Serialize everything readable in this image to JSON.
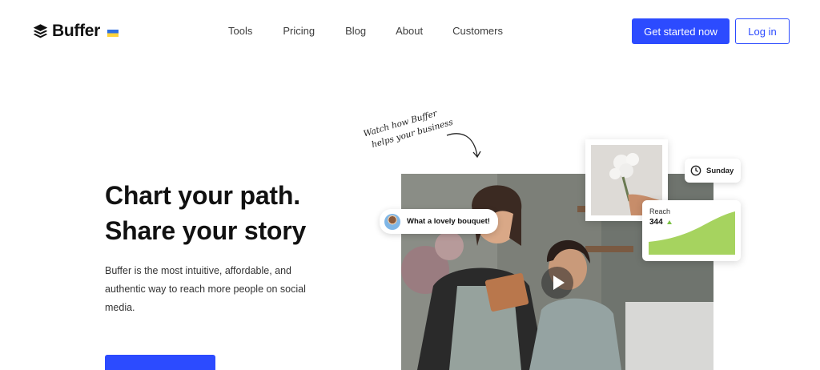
{
  "nav": {
    "brand": "Buffer",
    "links": [
      "Tools",
      "Pricing",
      "Blog",
      "About",
      "Customers"
    ],
    "cta_primary": "Get started now",
    "cta_secondary": "Log in"
  },
  "hero": {
    "title_line1": "Chart your path.",
    "title_line2": "Share your story",
    "description": "Buffer is the most intuitive, affordable, and authentic way to reach more people on social media.",
    "watch_line1": "Watch how Buffer",
    "watch_line2": "helps your business"
  },
  "cards": {
    "comment": "What a lovely bouquet!",
    "schedule_day": "Sunday",
    "reach_label": "Reach",
    "reach_value": "344"
  },
  "colors": {
    "accent": "#2c4bff",
    "chart_fill": "#a6d35f"
  },
  "icons": {
    "logo": "buffer-stack-icon",
    "flag": "ukraine-flag-icon",
    "play": "play-icon",
    "clock": "clock-icon",
    "trend_up": "triangle-up-icon",
    "arrow": "curved-arrow-icon"
  }
}
